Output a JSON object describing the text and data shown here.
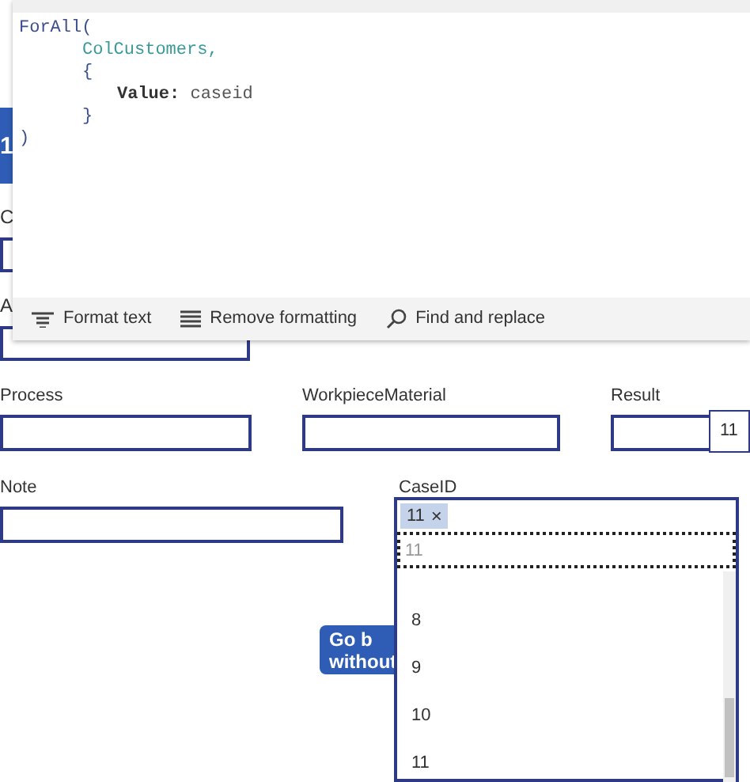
{
  "header": {
    "text": "1"
  },
  "left_fields": [
    {
      "label": "C"
    },
    {
      "label": "A"
    }
  ],
  "editor": {
    "lines": [
      {
        "kind": "plain",
        "text": "ForAll(",
        "children": [
          {
            "kind": "ident",
            "text": "ColCustomers,"
          },
          {
            "kind": "plain",
            "text": "{",
            "children": [
              {
                "kind": "pair",
                "key": "Value:",
                "text": "caseid"
              }
            ]
          },
          {
            "kind": "plain",
            "text": "}"
          }
        ]
      },
      {
        "kind": "plain",
        "text": ")"
      }
    ],
    "toolbar": [
      {
        "kind": "format",
        "label": "Format text"
      },
      {
        "kind": "remove",
        "label": "Remove formatting"
      },
      {
        "kind": "find",
        "label": "Find and replace"
      }
    ]
  },
  "fields": [
    {
      "label": "Process"
    },
    {
      "label": "WorkpieceMaterial"
    },
    {
      "label": "Result",
      "value": "11"
    }
  ],
  "note": {
    "label": "Note"
  },
  "caseid": {
    "label": "CaseID",
    "chips": [
      "11"
    ],
    "chip_remove": "×",
    "search_placeholder": "11",
    "options": [
      "8",
      "9",
      "10",
      "11"
    ]
  },
  "button": {
    "lines": [
      "Go b",
      "without"
    ]
  }
}
